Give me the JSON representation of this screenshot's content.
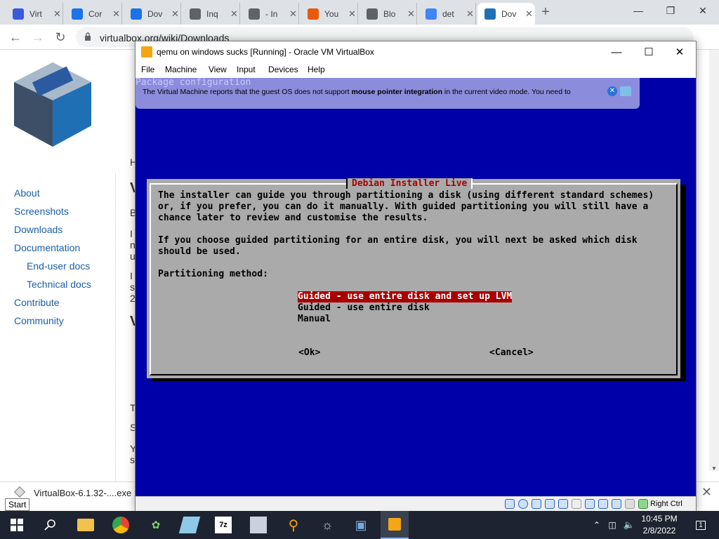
{
  "browser": {
    "tabs": [
      {
        "label": "Virt",
        "favicon": "sigma-icon",
        "color": "#3b5bdb"
      },
      {
        "label": "Cor",
        "favicon": "pin-icon",
        "color": "#1a73e8"
      },
      {
        "label": "Dov",
        "favicon": "download-icon",
        "color": "#1a73e8"
      },
      {
        "label": "Inq",
        "favicon": "globe-icon",
        "color": "#5f6368"
      },
      {
        "label": "- In",
        "favicon": "globe-icon",
        "color": "#5f6368"
      },
      {
        "label": "You",
        "favicon": "m-icon",
        "color": "#e8590c"
      },
      {
        "label": "Blo",
        "favicon": "globe-icon",
        "color": "#5f6368"
      },
      {
        "label": "det",
        "favicon": "google-icon",
        "color": "#4285f4"
      },
      {
        "label": "Dov",
        "favicon": "virtualbox-icon",
        "color": "#1f6fb5"
      }
    ],
    "url": "virtualbox.org/wiki/Downloads"
  },
  "page": {
    "nav": [
      {
        "label": "About",
        "sub": false
      },
      {
        "label": "Screenshots",
        "sub": false
      },
      {
        "label": "Downloads",
        "sub": false
      },
      {
        "label": "Documentation",
        "sub": false
      },
      {
        "label": "End-user docs",
        "sub": true
      },
      {
        "label": "Technical docs",
        "sub": true
      },
      {
        "label": "Contribute",
        "sub": false
      },
      {
        "label": "Community",
        "sub": false
      }
    ]
  },
  "download": {
    "filename": "VirtualBox-6.1.32-....exe",
    "start_tooltip": "Start"
  },
  "vbox": {
    "title": "qemu on windows sucks [Running] - Oracle VM VirtualBox",
    "menu": [
      "File",
      "Machine",
      "View",
      "Input",
      "Devices",
      "Help"
    ],
    "status_hostkey": "Right Ctrl"
  },
  "notification": {
    "behind_text": "Package configuration",
    "message_pre": "The Virtual Machine reports that the guest OS does not support ",
    "message_bold": "mouse pointer integration",
    "message_post": " in the current video mode. You need to"
  },
  "installer": {
    "title": "Debian Installer Live",
    "paragraph1": "The installer can guide you through partitioning a disk (using different standard schemes)\nor, if you prefer, you can do it manually. With guided partitioning you will still have a\nchance later to review and customise the results.",
    "paragraph2": "If you choose guided partitioning for an entire disk, you will next be asked which disk\nshould be used.",
    "prompt": "Partitioning method:",
    "options": [
      {
        "label": "Guided - use entire disk and set up LVM",
        "selected": true
      },
      {
        "label": "Guided - use entire disk",
        "selected": false
      },
      {
        "label": "Manual",
        "selected": false
      }
    ],
    "ok": "<Ok>",
    "cancel": "<Cancel>"
  },
  "taskbar": {
    "time": "10:45 PM",
    "date": "2/8/2022",
    "notifications": "1"
  }
}
